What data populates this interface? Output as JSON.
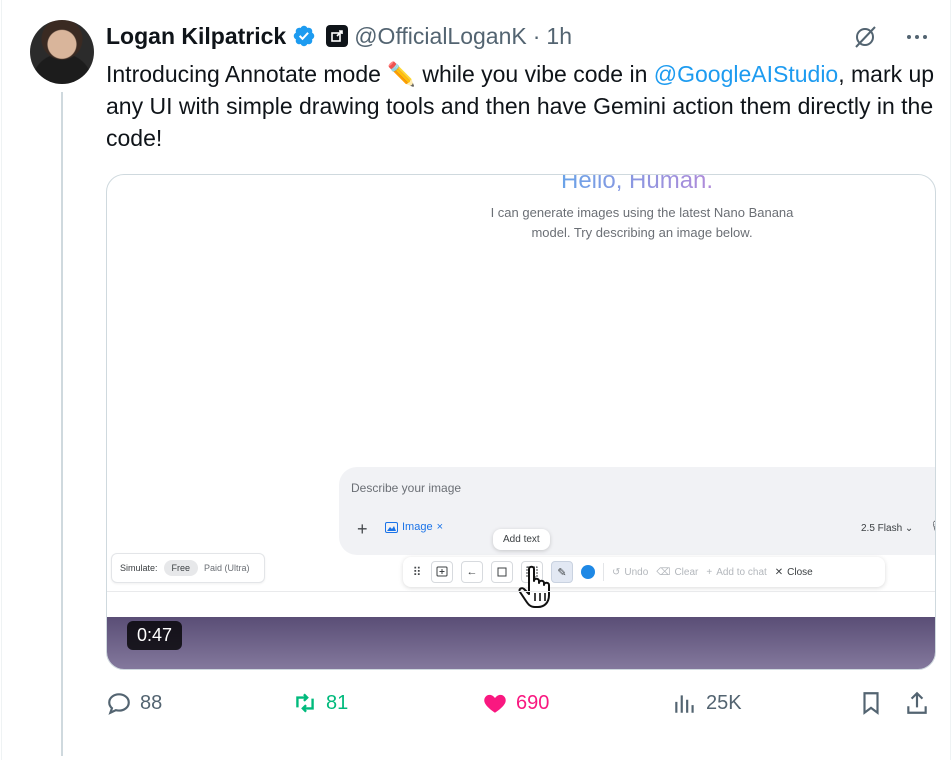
{
  "author": {
    "name": "Logan Kilpatrick",
    "handle": "@OfficialLoganK",
    "separator": "·",
    "time": "1h"
  },
  "tweet": {
    "text_part1": "Introducing Annotate mode ✏️ while you vibe code in ",
    "mention": "@GoogleAIStudio",
    "text_part2": ", mark up any UI with simple drawing tools and then have Gemini action them directly in the code!"
  },
  "media": {
    "hello_text": "Hello, Human.",
    "subtitle": "I can generate images using the latest Nano Banana model. Try describing an image below.",
    "composer_placeholder": "Describe your image",
    "plus_label": "+",
    "chip_label": "Image",
    "chip_close": "×",
    "model_label": "2.5 Flash ⌄",
    "simulate_label": "Simulate:",
    "simulate_free": "Free",
    "simulate_paid": "Paid (Ultra)",
    "tooltip": "Add text",
    "toolbar": {
      "undo": "Undo",
      "clear": "Clear",
      "add_to_chat": "Add to chat",
      "close": "Close"
    },
    "duration": "0:47",
    "accent_color": "#1e88e5",
    "video_bar_color": "#5a4e76"
  },
  "actions": {
    "replies": "88",
    "retweets": "81",
    "likes": "690",
    "views": "25K"
  },
  "colors": {
    "link": "#1d9bf0",
    "retweet": "#00ba7c",
    "like": "#f91880",
    "muted": "#536471"
  },
  "icons": [
    "verified-badge-icon",
    "affiliate-icon",
    "grok-icon",
    "more-icon",
    "reply-icon",
    "retweet-icon",
    "heart-icon",
    "views-icon",
    "bookmark-icon",
    "share-icon"
  ]
}
